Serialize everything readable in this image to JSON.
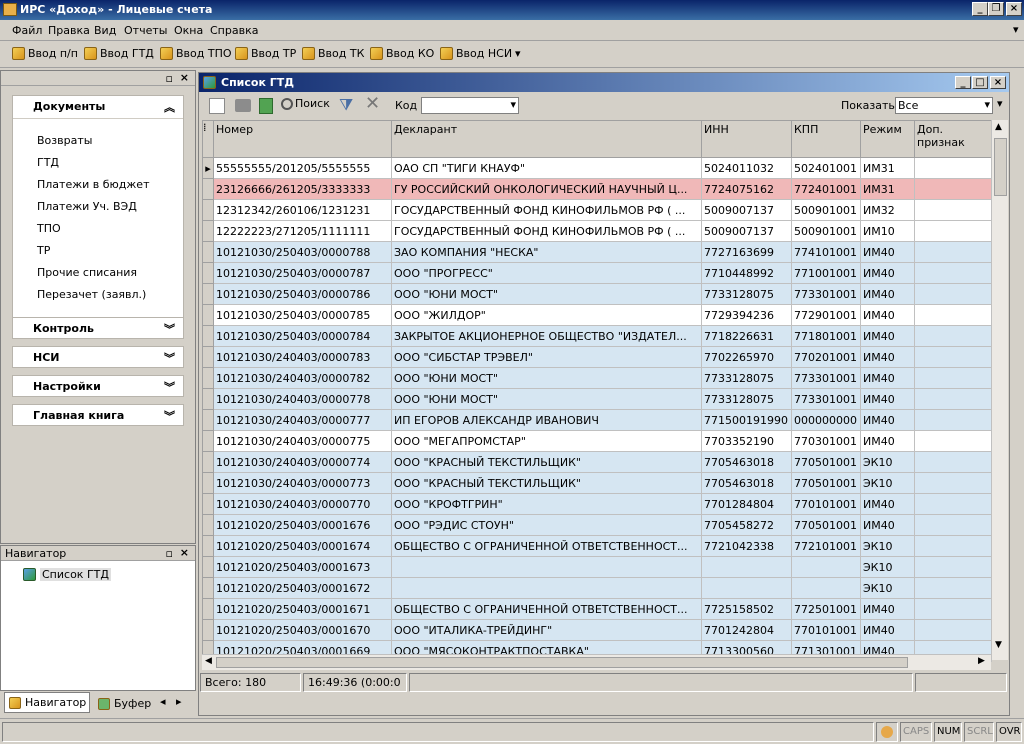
{
  "window": {
    "title": "ИРС «Доход» - Лицевые счета"
  },
  "menu": [
    "Файл",
    "Правка",
    "Вид",
    "Отчеты",
    "Окна",
    "Справка"
  ],
  "toolbar": [
    "Ввод п/п",
    "Ввод ГТД",
    "Ввод ТПО",
    "Ввод ТР",
    "Ввод ТК",
    "Ввод КО",
    "Ввод НСИ"
  ],
  "left": {
    "sections": [
      {
        "label": "Документы",
        "expanded": true,
        "items": [
          "Возвраты",
          "ГТД",
          "Платежи в бюджет",
          "Платежи Уч. ВЭД",
          "ТПО",
          "ТР",
          "Прочие списания",
          "Перезачет (заявл.)"
        ]
      },
      {
        "label": "Контроль"
      },
      {
        "label": "НСИ"
      },
      {
        "label": "Настройки"
      },
      {
        "label": "Главная книга"
      }
    ],
    "navigator_title": "Навигатор",
    "navigator_item": "Список ГТД",
    "tabs": [
      "Навигатор",
      "Буфер"
    ]
  },
  "grid": {
    "title": "Список ГТД",
    "search_label": "Поиск",
    "code_label": "Код",
    "show_label": "Показать",
    "show_value": "Все",
    "columns": [
      "Номер",
      "Декларант",
      "ИНН",
      "КПП",
      "Режим",
      "Доп. признак"
    ],
    "rows": [
      {
        "c": "white",
        "v": [
          "55555555/201205/5555555",
          "ОАО СП \"ТИГИ КНАУФ\"",
          "5024011032",
          "502401001",
          "ИМ31",
          ""
        ]
      },
      {
        "c": "pink",
        "v": [
          "23126666/261205/3333333",
          "ГУ РОССИЙСКИЙ ОНКОЛОГИЧЕСКИЙ НАУЧНЫЙ Ц...",
          "7724075162",
          "772401001",
          "ИМ31",
          ""
        ]
      },
      {
        "c": "white",
        "v": [
          "12312342/260106/1231231",
          "ГОСУДАРСТВЕННЫЙ ФОНД КИНОФИЛЬМОВ РФ ( ...",
          "5009007137",
          "500901001",
          "ИМ32",
          ""
        ]
      },
      {
        "c": "white",
        "v": [
          "12222223/271205/1111111",
          "ГОСУДАРСТВЕННЫЙ ФОНД КИНОФИЛЬМОВ РФ ( ...",
          "5009007137",
          "500901001",
          "ИМ10",
          ""
        ]
      },
      {
        "c": "blue",
        "v": [
          "10121030/250403/0000788",
          "ЗАО КОМПАНИЯ \"НЕСКА\"",
          "7727163699",
          "774101001",
          "ИМ40",
          ""
        ]
      },
      {
        "c": "blue",
        "v": [
          "10121030/250403/0000787",
          "ООО \"ПРОГРЕСС\"",
          "7710448992",
          "771001001",
          "ИМ40",
          ""
        ]
      },
      {
        "c": "blue",
        "v": [
          "10121030/250403/0000786",
          "ООО \"ЮНИ МОСТ\"",
          "7733128075",
          "773301001",
          "ИМ40",
          ""
        ]
      },
      {
        "c": "white",
        "v": [
          "10121030/250403/0000785",
          "ООО \"ЖИЛДОР\"",
          "7729394236",
          "772901001",
          "ИМ40",
          ""
        ]
      },
      {
        "c": "blue",
        "v": [
          "10121030/250403/0000784",
          "ЗАКРЫТОЕ АКЦИОНЕРНОЕ ОБЩЕСТВО \"ИЗДАТЕЛ...",
          "7718226631",
          "771801001",
          "ИМ40",
          ""
        ]
      },
      {
        "c": "blue",
        "v": [
          "10121030/240403/0000783",
          "ООО \"СИБСТАР ТРЭВЕЛ\"",
          "7702265970",
          "770201001",
          "ИМ40",
          ""
        ]
      },
      {
        "c": "blue",
        "v": [
          "10121030/240403/0000782",
          "ООО \"ЮНИ МОСТ\"",
          "7733128075",
          "773301001",
          "ИМ40",
          ""
        ]
      },
      {
        "c": "blue",
        "v": [
          "10121030/240403/0000778",
          "ООО \"ЮНИ МОСТ\"",
          "7733128075",
          "773301001",
          "ИМ40",
          ""
        ]
      },
      {
        "c": "blue",
        "v": [
          "10121030/240403/0000777",
          "ИП ЕГОРОВ АЛЕКСАНДР ИВАНОВИЧ",
          "771500191990",
          "000000000",
          "ИМ40",
          ""
        ]
      },
      {
        "c": "white",
        "v": [
          "10121030/240403/0000775",
          "ООО \"МЕГАПРОМСТАР\"",
          "7703352190",
          "770301001",
          "ИМ40",
          ""
        ]
      },
      {
        "c": "blue",
        "v": [
          "10121030/240403/0000774",
          "ООО \"КРАСНЫЙ ТЕКСТИЛЬЩИК\"",
          "7705463018",
          "770501001",
          "ЭК10",
          ""
        ]
      },
      {
        "c": "blue",
        "v": [
          "10121030/240403/0000773",
          "ООО \"КРАСНЫЙ ТЕКСТИЛЬЩИК\"",
          "7705463018",
          "770501001",
          "ЭК10",
          ""
        ]
      },
      {
        "c": "blue",
        "v": [
          "10121030/240403/0000770",
          "ООО \"КРОФТГРИН\"",
          "7701284804",
          "770101001",
          "ИМ40",
          ""
        ]
      },
      {
        "c": "blue",
        "v": [
          "10121020/250403/0001676",
          "ООО \"РЭДИС СТОУН\"",
          "7705458272",
          "770501001",
          "ИМ40",
          ""
        ]
      },
      {
        "c": "blue",
        "v": [
          "10121020/250403/0001674",
          "ОБЩЕСТВО С ОГРАНИЧЕННОЙ ОТВЕТСТВЕННОСТ...",
          "7721042338",
          "772101001",
          "ЭК10",
          ""
        ]
      },
      {
        "c": "blue",
        "v": [
          "10121020/250403/0001673",
          "",
          "",
          "",
          "ЭК10",
          ""
        ]
      },
      {
        "c": "blue",
        "v": [
          "10121020/250403/0001672",
          "",
          "",
          "",
          "ЭК10",
          ""
        ]
      },
      {
        "c": "blue",
        "v": [
          "10121020/250403/0001671",
          "ОБЩЕСТВО С ОГРАНИЧЕННОЙ ОТВЕТСТВЕННОСТ...",
          "7725158502",
          "772501001",
          "ИМ40",
          ""
        ]
      },
      {
        "c": "blue",
        "v": [
          "10121020/250403/0001670",
          "ООО \"ИТАЛИКА-ТРЕЙДИНГ\"",
          "7701242804",
          "770101001",
          "ИМ40",
          ""
        ]
      },
      {
        "c": "blue",
        "v": [
          "10121020/250403/0001669",
          "ООО \"МЯСОКОНТРАКТПОСТАВКА\"",
          "7713300560",
          "771301001",
          "ИМ40",
          ""
        ]
      }
    ],
    "status_total": "Всего: 180",
    "status_time": "16:49:36 (0:00:0"
  },
  "statusbar": [
    "CAPS",
    "NUM",
    "SCRL",
    "OVR"
  ]
}
